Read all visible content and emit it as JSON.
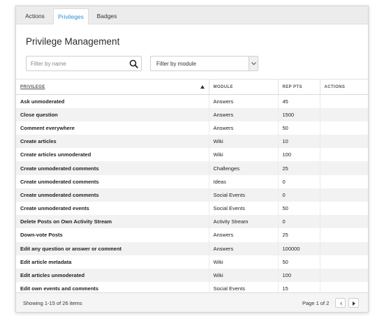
{
  "tabs": [
    {
      "label": "Actions",
      "active": false
    },
    {
      "label": "Privileges",
      "active": true
    },
    {
      "label": "Badges",
      "active": false
    }
  ],
  "page_title": "Privilege Management",
  "filter": {
    "name_placeholder": "Filter by name",
    "module_selected": "Filter by module"
  },
  "columns": [
    "PRIVILEGE",
    "MODULE",
    "REP PTS",
    "ACTIONS"
  ],
  "rows": [
    {
      "privilege": "Ask unmoderated",
      "module": "Answers",
      "rep_pts": "45"
    },
    {
      "privilege": "Close question",
      "module": "Answers",
      "rep_pts": "1500"
    },
    {
      "privilege": "Comment everywhere",
      "module": "Answers",
      "rep_pts": "50"
    },
    {
      "privilege": "Create articles",
      "module": "Wiki",
      "rep_pts": "10"
    },
    {
      "privilege": "Create articles unmoderated",
      "module": "Wiki",
      "rep_pts": "100"
    },
    {
      "privilege": "Create unmoderated comments",
      "module": "Challenges",
      "rep_pts": "25"
    },
    {
      "privilege": "Create unmoderated comments",
      "module": "Ideas",
      "rep_pts": "0"
    },
    {
      "privilege": "Create unmoderated comments",
      "module": "Social Events",
      "rep_pts": "0"
    },
    {
      "privilege": "Create unmoderated events",
      "module": "Social Events",
      "rep_pts": "50"
    },
    {
      "privilege": "Delete Posts on Own Activity Stream",
      "module": "Activity Stream",
      "rep_pts": "0"
    },
    {
      "privilege": "Down-vote Posts",
      "module": "Answers",
      "rep_pts": "25"
    },
    {
      "privilege": "Edit any question or answer or comment",
      "module": "Answers",
      "rep_pts": "100000"
    },
    {
      "privilege": "Edit article metadata",
      "module": "Wiki",
      "rep_pts": "50"
    },
    {
      "privilege": "Edit articles unmoderated",
      "module": "Wiki",
      "rep_pts": "100"
    },
    {
      "privilege": "Edit own events and comments",
      "module": "Social Events",
      "rep_pts": "15"
    }
  ],
  "footer": {
    "showing": "Showing 1-15 of 26 items",
    "page": "Page 1 of 2"
  },
  "colors": {
    "accent": "#2b8fd6",
    "stripe": "#f2f2f2",
    "border": "#d4d4d4"
  },
  "icons": {
    "search": "search-icon",
    "dropdown": "chevron-down-icon",
    "sort": "sort-ascending-icon",
    "prev": "chevron-left-icon",
    "next": "chevron-right-icon"
  }
}
